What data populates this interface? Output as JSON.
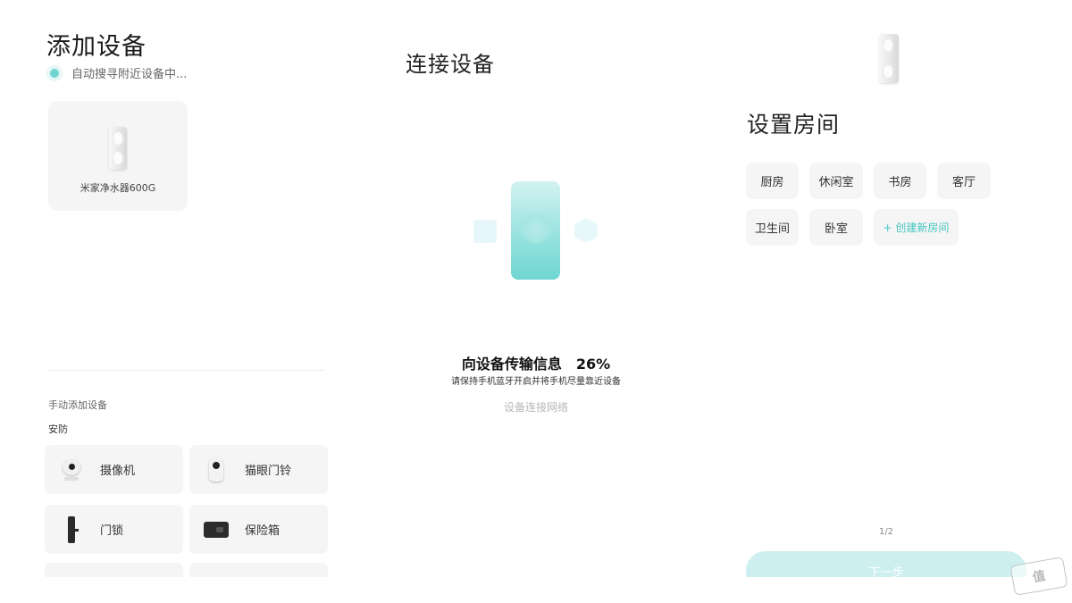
{
  "add_device": {
    "title": "添加设备",
    "scanning_text": "自动搜寻附近设备中...",
    "found_device": {
      "name": "米家净水器600G",
      "icon": "water-purifier-icon"
    },
    "manual_section": {
      "label": "手动添加设备",
      "category": "安防",
      "devices": [
        {
          "name": "摄像机",
          "icon": "camera-icon"
        },
        {
          "name": "猫眼门铃",
          "icon": "doorbell-icon"
        },
        {
          "name": "门锁",
          "icon": "door-lock-icon"
        },
        {
          "name": "保险箱",
          "icon": "safe-icon"
        }
      ]
    }
  },
  "connect_device": {
    "title": "连接设备",
    "status_text": "向设备传输信息",
    "progress_percent": "26%",
    "hint": "请保持手机蓝牙开启并将手机尽量靠近设备",
    "next_step": "设备连接网络"
  },
  "set_room": {
    "title": "设置房间",
    "rooms": [
      "厨房",
      "休闲室",
      "书房",
      "客厅",
      "卫生间",
      "卧室"
    ],
    "create_room": "+ 创建新房间",
    "page_indicator": "1/2",
    "next_button": "下一步"
  },
  "watermark": "什么值",
  "colors": {
    "accent": "#48c5c2",
    "accent_light": "#cdeff0",
    "tile_bg": "#f5f5f5"
  }
}
